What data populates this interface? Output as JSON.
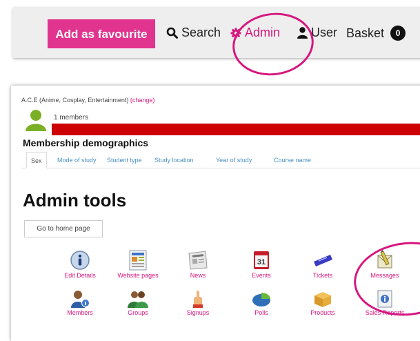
{
  "top_bar": {
    "favourite_label": "Add as favourite",
    "nav": [
      {
        "label": "Search",
        "icon": "search-icon"
      },
      {
        "label": "Admin",
        "icon": "gear-icon"
      },
      {
        "label": "User",
        "icon": "user-icon"
      },
      {
        "label": "Basket",
        "icon": "basket-count-badge"
      }
    ],
    "basket_count": "0"
  },
  "group": {
    "name": "A.C.E (Anime, Cosplay, Entertainment)",
    "change_label": "(change)",
    "members": "1 members"
  },
  "demographics": {
    "title": "Membership demographics",
    "tabs": [
      "Sex",
      "Mode of study",
      "Student type",
      "Study location",
      "Year of study",
      "Course name"
    ],
    "active_tab": "Sex"
  },
  "admin_tools": {
    "title": "Admin tools",
    "home_button": "Go to home page",
    "row1": [
      {
        "label": "Edit Details",
        "icon": "info-icon"
      },
      {
        "label": "Website pages",
        "icon": "website-pages-icon"
      },
      {
        "label": "News",
        "icon": "newspaper-icon"
      },
      {
        "label": "Events",
        "icon": "calendar-icon"
      },
      {
        "label": "Tickets",
        "icon": "ticket-icon"
      },
      {
        "label": "Messages",
        "icon": "messages-icon"
      }
    ],
    "row2": [
      {
        "label": "Members",
        "icon": "member-icon"
      },
      {
        "label": "Groups",
        "icon": "groups-icon"
      },
      {
        "label": "Signups",
        "icon": "signup-icon"
      },
      {
        "label": "Polls",
        "icon": "pie-chart-icon"
      },
      {
        "label": "Products",
        "icon": "box-icon"
      },
      {
        "label": "Sales Reports",
        "icon": "report-icon"
      }
    ]
  },
  "colors": {
    "accent": "#e1348f",
    "highlight_ring": "#d6177f",
    "bar": "#cc0000",
    "tab_link": "#4a90c2"
  }
}
